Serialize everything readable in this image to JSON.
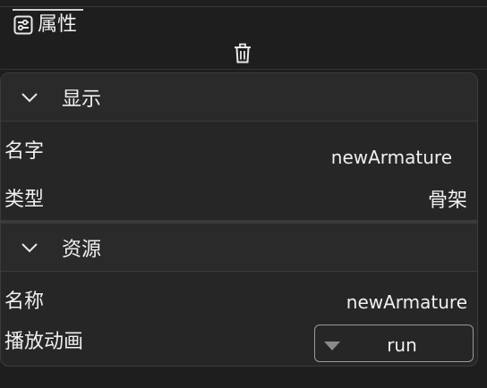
{
  "tab": {
    "label": "属性",
    "icon": "sliders-icon"
  },
  "toolbar": {
    "delete_icon": "trash-icon"
  },
  "sections": [
    {
      "title": "显示",
      "properties": [
        {
          "label": "名字",
          "value": "newArmature"
        },
        {
          "label": "类型",
          "value": "骨架"
        }
      ]
    },
    {
      "title": "资源",
      "properties": [
        {
          "label": "名称",
          "value": "newArmature"
        },
        {
          "label": "播放动画",
          "value": "run",
          "control": "dropdown"
        }
      ]
    }
  ],
  "colors": {
    "background": "#1e1e1e",
    "panel": "#262626",
    "text": "#f0f0f0",
    "border": "#3c3c3c"
  }
}
